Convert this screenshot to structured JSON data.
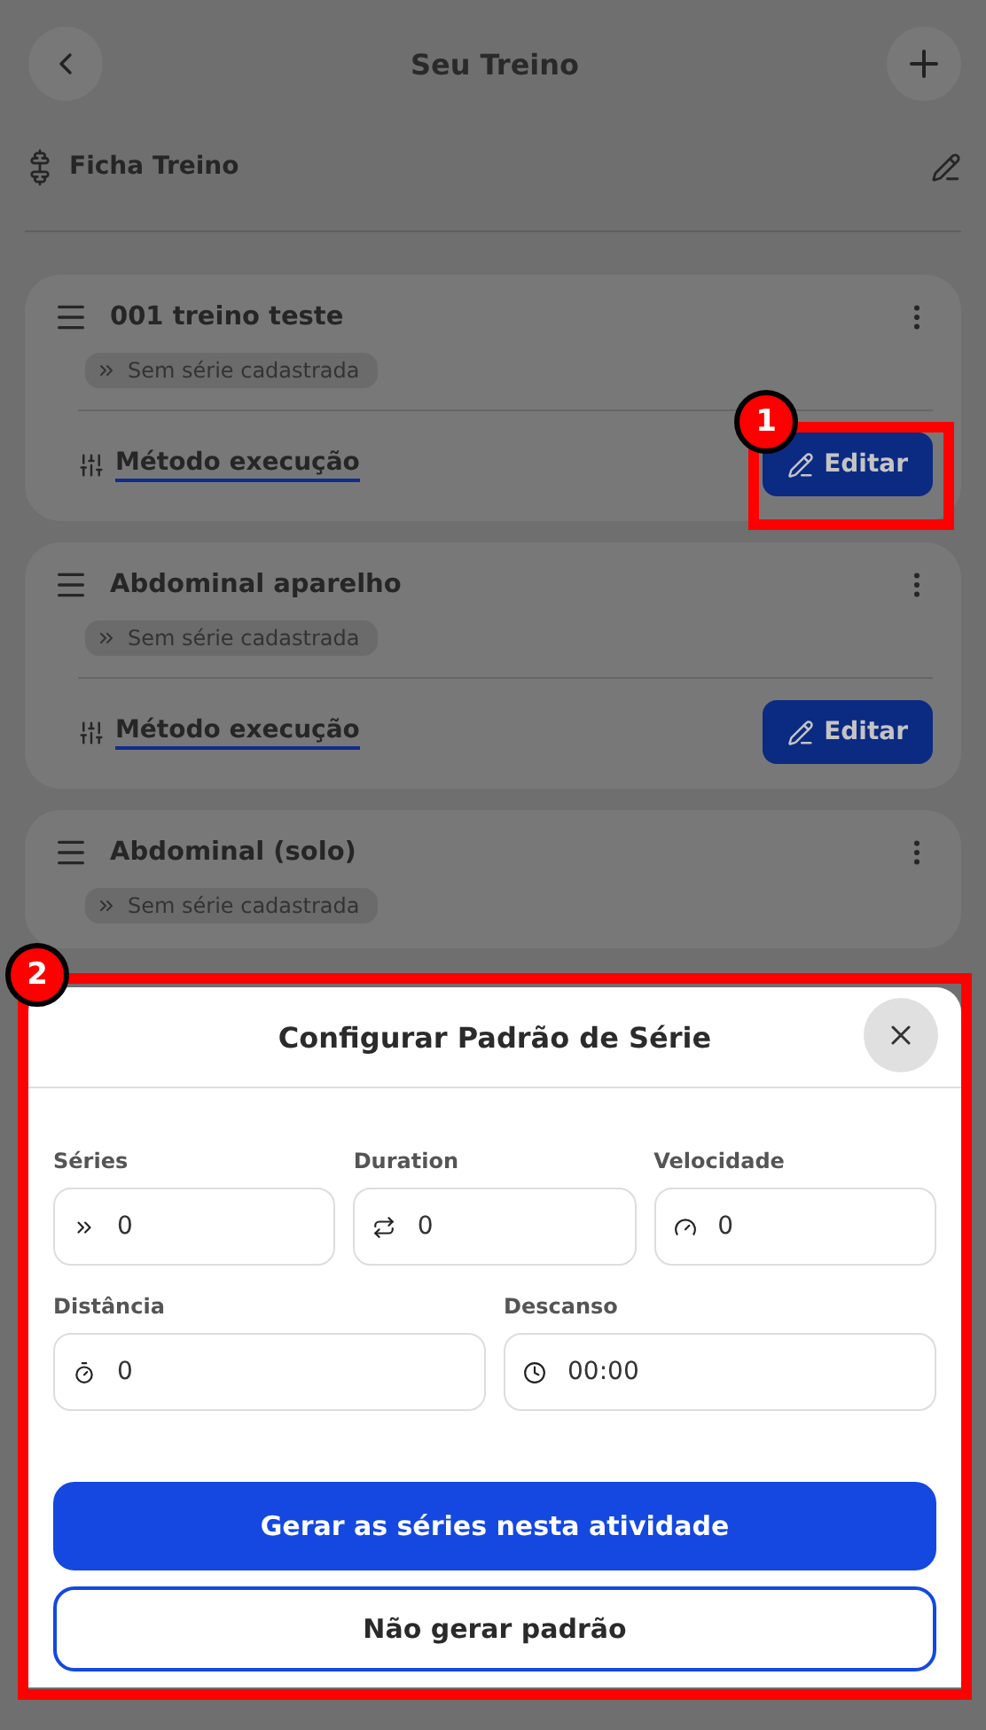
{
  "header": {
    "title": "Seu Treino"
  },
  "sheet_row": {
    "title": "Ficha Treino"
  },
  "exercises": [
    {
      "title": "001 treino teste",
      "badge": "Sem série cadastrada",
      "method": "Método execução",
      "button": "Editar"
    },
    {
      "title": "Abdominal aparelho",
      "badge": "Sem série cadastrada",
      "method": "Método execução",
      "button": "Editar"
    },
    {
      "title": "Abdominal (solo)",
      "badge": "Sem série cadastrada"
    }
  ],
  "modal": {
    "title": "Configurar Padrão de Série",
    "field_rows": [
      [
        {
          "label": "Séries",
          "value": "0"
        },
        {
          "label": "Duration",
          "value": "0"
        },
        {
          "label": "Velocidade",
          "value": "0"
        }
      ],
      [
        {
          "label": "Distância",
          "value": "0"
        },
        {
          "label": "Descanso",
          "value": "00:00"
        }
      ]
    ],
    "primary_button": "Gerar as séries nesta atividade",
    "secondary_button": "Não gerar padrão"
  },
  "annotations": [
    {
      "label": "1"
    },
    {
      "label": "2"
    }
  ]
}
